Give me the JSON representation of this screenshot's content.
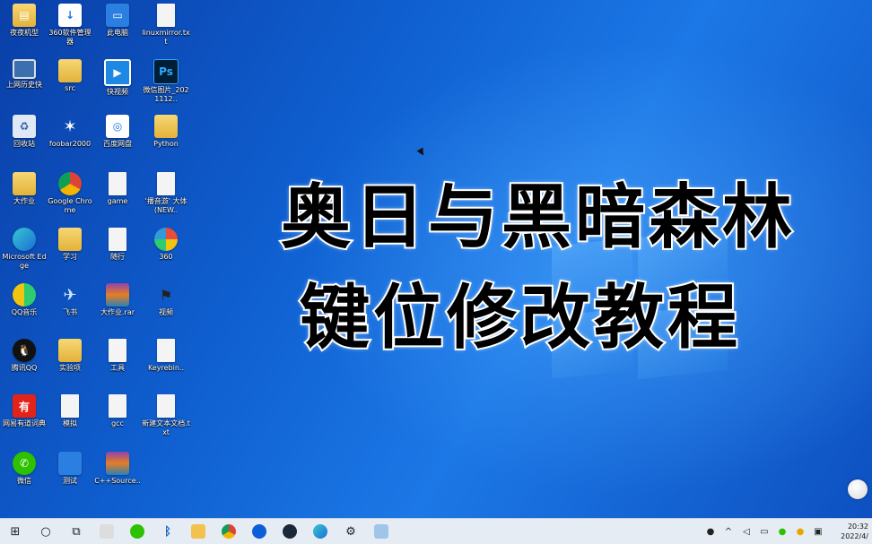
{
  "headline": {
    "line1": "奥日与黑暗森林",
    "line2": "键位修改教程"
  },
  "desktop_icons": [
    {
      "label": "夜夜机型",
      "icon": "archive-icon"
    },
    {
      "label": "360软件管理器",
      "icon": "app-icon"
    },
    {
      "label": "此电脑",
      "icon": "computer-icon"
    },
    {
      "label": "linuxmirror.txt",
      "icon": "file-icon"
    },
    {
      "label": "上网历史快",
      "icon": "monitor-icon"
    },
    {
      "label": "src",
      "icon": "folder-icon"
    },
    {
      "label": "快视频",
      "icon": "tv-icon"
    },
    {
      "label": "微信图片_2021112..",
      "icon": "photoshop-icon"
    },
    {
      "label": "回收站",
      "icon": "recycle-bin-icon"
    },
    {
      "label": "foobar2000",
      "icon": "foobar-icon"
    },
    {
      "label": "百度网盘",
      "icon": "app-icon"
    },
    {
      "label": "Python",
      "icon": "folder-icon"
    },
    {
      "label": "大作业",
      "icon": "folder-icon"
    },
    {
      "label": "Google Chrome",
      "icon": "chrome-icon"
    },
    {
      "label": "game",
      "icon": "file-icon"
    },
    {
      "label": "'播音游' 大体(NEW..",
      "icon": "file-icon"
    },
    {
      "label": "Microsoft Edge",
      "icon": "edge-icon"
    },
    {
      "label": "学习",
      "icon": "folder-icon"
    },
    {
      "label": "随行",
      "icon": "file-icon"
    },
    {
      "label": "360",
      "icon": "360-icon"
    },
    {
      "label": "QQ音乐",
      "icon": "music-icon"
    },
    {
      "label": "飞书",
      "icon": "bird-icon"
    },
    {
      "label": "大作业.rar",
      "icon": "winrar-icon"
    },
    {
      "label": "视频",
      "icon": "flag-icon"
    },
    {
      "label": "腾讯QQ",
      "icon": "qq-icon"
    },
    {
      "label": "实验项",
      "icon": "folder-icon"
    },
    {
      "label": "工具",
      "icon": "file-icon"
    },
    {
      "label": "Keyrebin..",
      "icon": "file-icon"
    },
    {
      "label": "网易有道词典",
      "icon": "youdao-icon"
    },
    {
      "label": "模拟",
      "icon": "file-icon"
    },
    {
      "label": "gcc",
      "icon": "file-icon"
    },
    {
      "label": "新建文本文档.txt",
      "icon": "file-icon"
    },
    {
      "label": "微信",
      "icon": "wechat-icon"
    },
    {
      "label": "测试",
      "icon": "app-icon"
    },
    {
      "label": "C++Source..",
      "icon": "winrar-icon"
    }
  ],
  "taskbar": {
    "clock_time": "20:32",
    "clock_date": "2022/4/",
    "apps": [
      "start-icon",
      "search-icon",
      "task-view-icon",
      "app-icon",
      "wechat-icon",
      "bluetooth-icon",
      "explorer-icon",
      "chrome-icon",
      "app-icon",
      "steam-icon",
      "edge-icon",
      "settings-icon",
      "notepad-icon"
    ]
  }
}
